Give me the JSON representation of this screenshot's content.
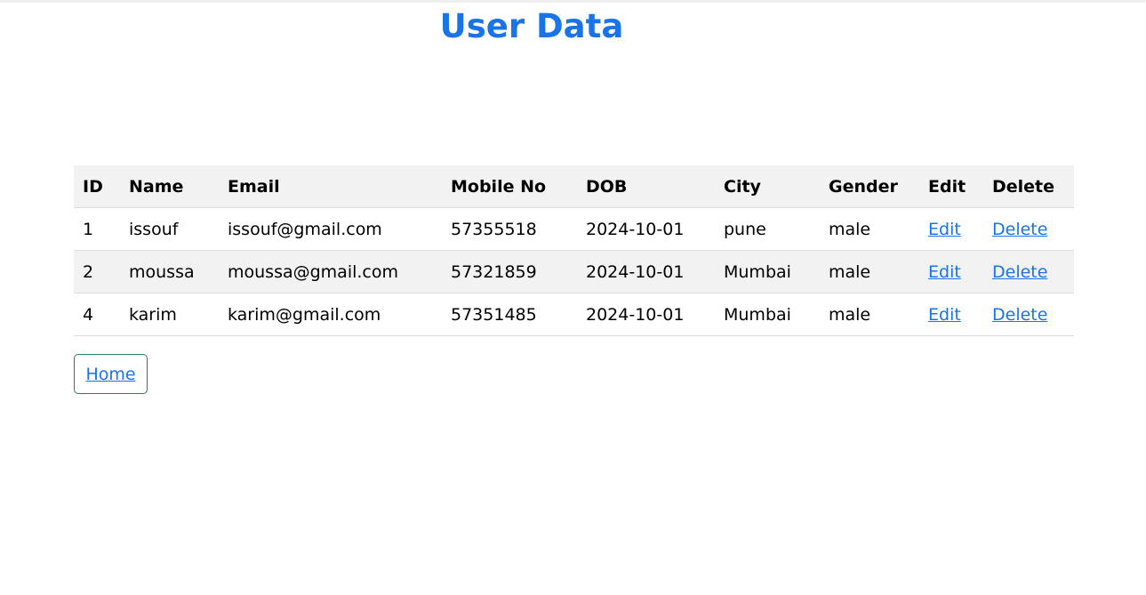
{
  "page": {
    "title": "User Data",
    "accent_color": "#1a73e8",
    "button_border_color": "#198754"
  },
  "table": {
    "headers": [
      "ID",
      "Name",
      "Email",
      "Mobile No",
      "DOB",
      "City",
      "Gender",
      "Edit",
      "Delete"
    ],
    "rows": [
      {
        "id": "1",
        "name": "issouf",
        "email": "issouf@gmail.com",
        "mobile": "57355518",
        "dob": "2024-10-01",
        "city": "pune",
        "gender": "male",
        "edit": "Edit",
        "delete": "Delete"
      },
      {
        "id": "2",
        "name": "moussa",
        "email": "moussa@gmail.com",
        "mobile": "57321859",
        "dob": "2024-10-01",
        "city": "Mumbai",
        "gender": "male",
        "edit": "Edit",
        "delete": "Delete"
      },
      {
        "id": "4",
        "name": "karim",
        "email": "karim@gmail.com",
        "mobile": "57351485",
        "dob": "2024-10-01",
        "city": "Mumbai",
        "gender": "male",
        "edit": "Edit",
        "delete": "Delete"
      }
    ]
  },
  "nav": {
    "home_label": "Home"
  }
}
